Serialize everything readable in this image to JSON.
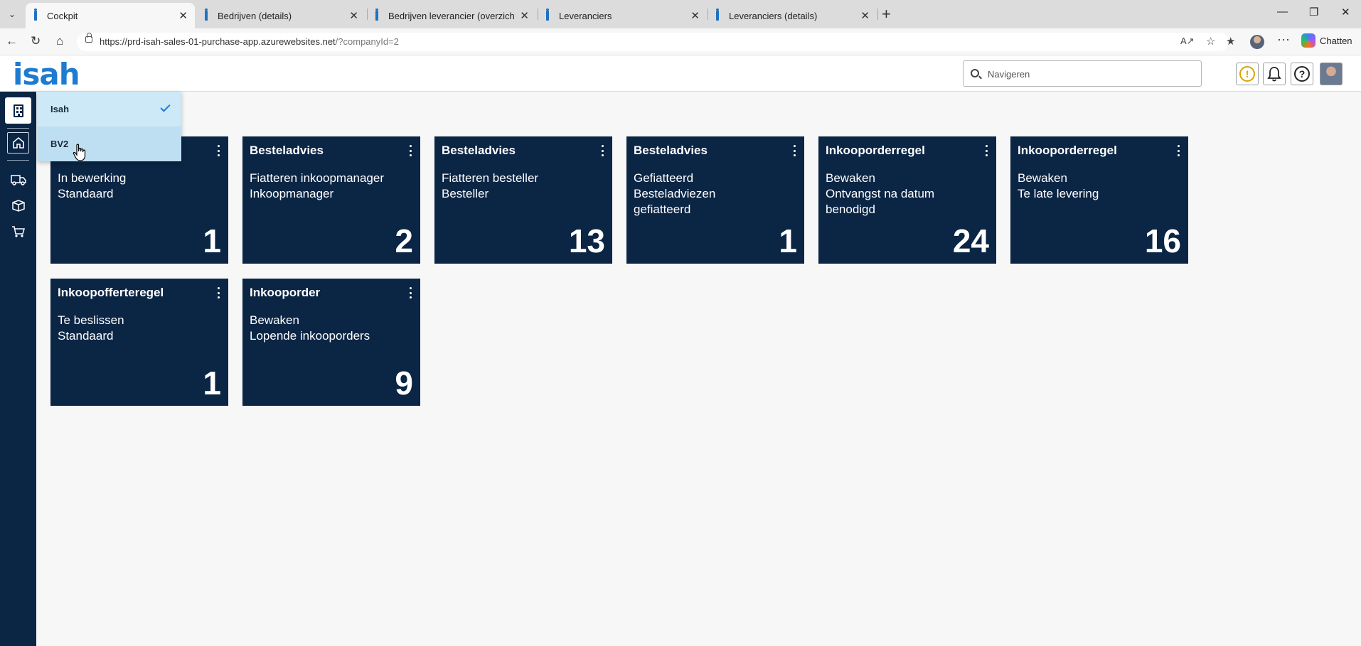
{
  "browser": {
    "tabs": [
      {
        "label": "Cockpit"
      },
      {
        "label": "Bedrijven (details)"
      },
      {
        "label": "Bedrijven leverancier (overzicht)"
      },
      {
        "label": "Leveranciers"
      },
      {
        "label": "Leveranciers (details)"
      }
    ],
    "url": {
      "host": "https://prd-isah-sales-01-purchase-app.azurewebsites.net",
      "path": "/?companyId=2"
    },
    "chat_label": "Chatten"
  },
  "header": {
    "logo": "isah",
    "search_placeholder": "Navigeren",
    "warning_glyph": "!",
    "help_glyph": "?"
  },
  "company_menu": {
    "items": [
      {
        "label": "Isah",
        "selected": true
      },
      {
        "label": "BV2",
        "selected": false
      }
    ]
  },
  "tiles": [
    {
      "title": "",
      "lines": [
        "In bewerking",
        "Standaard"
      ],
      "count": "1"
    },
    {
      "title": "Besteladvies",
      "lines": [
        "Fiatteren inkoopmanager",
        "Inkoopmanager"
      ],
      "count": "2"
    },
    {
      "title": "Besteladvies",
      "lines": [
        "Fiatteren besteller",
        "Besteller"
      ],
      "count": "13"
    },
    {
      "title": "Besteladvies",
      "lines": [
        "Gefiatteerd",
        "Besteladviezen",
        "gefiatteerd"
      ],
      "count": "1"
    },
    {
      "title": "Inkooporderregel",
      "lines": [
        "Bewaken",
        "Ontvangst na datum",
        "benodigd"
      ],
      "count": "24"
    },
    {
      "title": "Inkooporderregel",
      "lines": [
        "Bewaken",
        "Te late levering"
      ],
      "count": "16"
    },
    {
      "title": "Inkoopofferteregel",
      "lines": [
        "Te beslissen",
        "Standaard"
      ],
      "count": "1"
    },
    {
      "title": "Inkooporder",
      "lines": [
        "Bewaken",
        "Lopende inkooporders"
      ],
      "count": "9"
    }
  ],
  "colors": {
    "tile_bg": "#0b2545",
    "logo": "#1e7bd0",
    "menu_bg": "#cde8f6",
    "warning": "#d9a400"
  }
}
